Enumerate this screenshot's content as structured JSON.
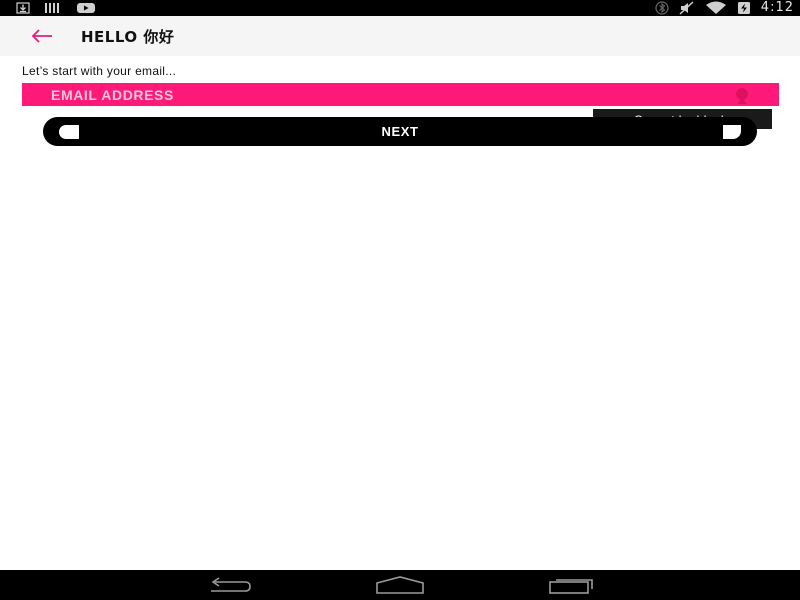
{
  "status_bar": {
    "time": "4:12",
    "icons_left": [
      "download-icon",
      "signal-bars-icon",
      "youtube-icon"
    ],
    "icons_right": [
      "bluetooth-icon",
      "mute-icon",
      "wifi-icon",
      "battery-charging-icon"
    ]
  },
  "app_bar": {
    "title": "HELLO 你好",
    "back_icon": "arrow-left-icon"
  },
  "form": {
    "prompt": "Let’s start with your email...",
    "email_placeholder": "EMAIL ADDRESS",
    "email_value": "",
    "error_message": "Cannot be blank.",
    "next_label": "NEXT"
  },
  "nav_bar": {
    "buttons": [
      "back-icon",
      "home-icon",
      "recents-icon"
    ]
  },
  "colors": {
    "accent": "#ff1a7a",
    "back_arrow": "#e0207a",
    "status_bar": "#000000",
    "app_bar": "#f5f5f5",
    "tooltip": "#1a1a1a"
  }
}
